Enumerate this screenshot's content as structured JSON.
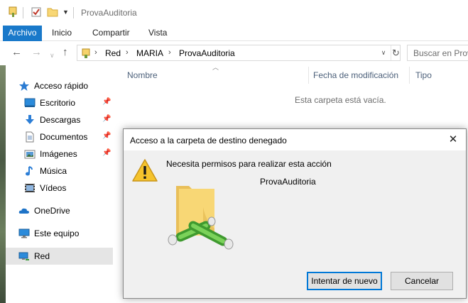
{
  "window": {
    "title": "ProvaAuditoria"
  },
  "ribbon": {
    "tabs": [
      "Archivo",
      "Inicio",
      "Compartir",
      "Vista"
    ]
  },
  "address": {
    "crumbs": [
      "Red",
      "MARIA",
      "ProvaAuditoria"
    ],
    "search_placeholder": "Buscar en Prova"
  },
  "navpane": {
    "quick_access": "Acceso rápido",
    "items": [
      {
        "label": "Escritorio",
        "icon": "desktop-icon",
        "pinned": true
      },
      {
        "label": "Descargas",
        "icon": "download-icon",
        "pinned": true
      },
      {
        "label": "Documentos",
        "icon": "document-icon",
        "pinned": true
      },
      {
        "label": "Imágenes",
        "icon": "pictures-icon",
        "pinned": true
      },
      {
        "label": "Música",
        "icon": "music-icon",
        "pinned": false
      },
      {
        "label": "Vídeos",
        "icon": "video-icon",
        "pinned": false
      }
    ],
    "onedrive": "OneDrive",
    "this_pc": "Este equipo",
    "network": "Red"
  },
  "content": {
    "columns": [
      "Nombre",
      "Fecha de modificación",
      "Tipo"
    ],
    "empty_message": "Esta carpeta está vacía."
  },
  "dialog": {
    "title": "Acceso a la carpeta de destino denegado",
    "message": "Necesita permisos para realizar esta acción",
    "folder_name": "ProvaAuditoria",
    "retry_label": "Intentar de nuevo",
    "cancel_label": "Cancelar",
    "close_glyph": "✕"
  },
  "colors": {
    "file_tab": "#1979ca",
    "column_header": "#4c607a",
    "selected_nav": "#e5e5e5",
    "primary_button_border": "#0078d7"
  }
}
